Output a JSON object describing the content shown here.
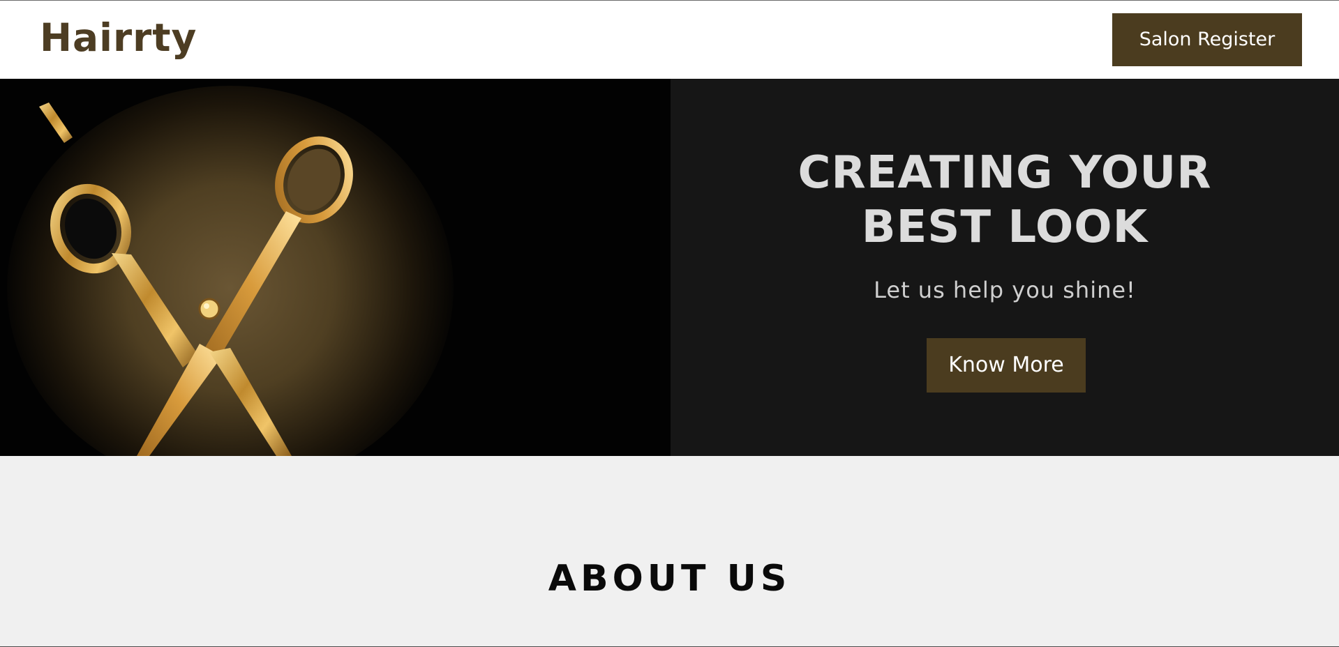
{
  "header": {
    "brand": "Hairrty",
    "register_label": "Salon Register"
  },
  "hero": {
    "image_icon": "golden-scissors-image",
    "title_line1": "CREATING YOUR",
    "title_line2": "BEST LOOK",
    "subtitle": "Let us help you shine!",
    "cta_label": "Know More"
  },
  "about": {
    "title": "ABOUT US"
  },
  "colors": {
    "brand": "#4d3d23",
    "button_bg": "#4b3c1f",
    "hero_panel_bg": "#161616",
    "hero_image_bg": "#020202",
    "about_bg": "#f0f0f0",
    "gold": "#d6a84a"
  }
}
